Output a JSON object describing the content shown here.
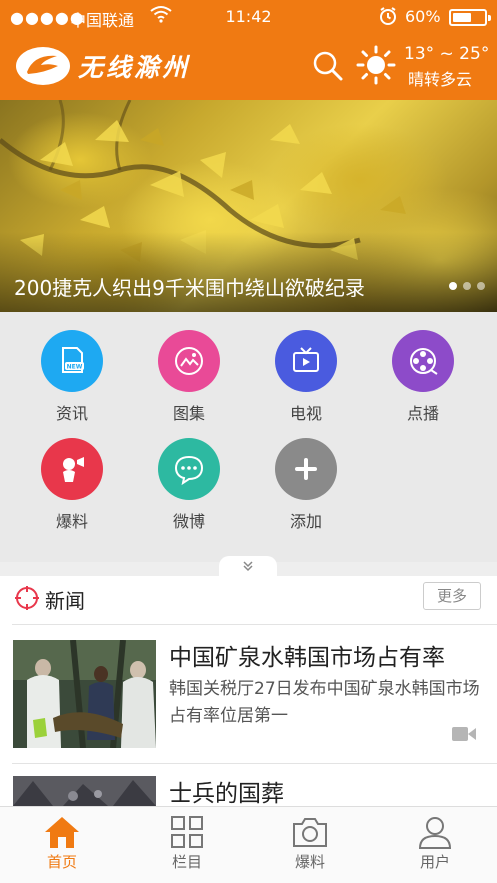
{
  "status_bar": {
    "signal": "●●●●●",
    "carrier": "中国联通",
    "time": "11:42",
    "battery": "60%",
    "battery_level": 0.6
  },
  "header": {
    "app_name": "无线滁州",
    "weather": {
      "temp": "13° ~ 25°",
      "condition": "晴转多云",
      "icon": "sun-icon"
    },
    "icons": [
      "search-icon",
      "sun-icon"
    ]
  },
  "banner": {
    "caption": "200捷克人织出9千米围巾绕山欲破纪录",
    "slides": 3,
    "active_slide": 1
  },
  "grid": {
    "items": [
      {
        "label": "资讯",
        "color": "#1ea9f2",
        "icon": "news-icon"
      },
      {
        "label": "图集",
        "color": "#e94a97",
        "icon": "gallery-icon"
      },
      {
        "label": "电视",
        "color": "#4a5bdf",
        "icon": "tv-icon"
      },
      {
        "label": "点播",
        "color": "#8d4bc9",
        "icon": "film-reel-icon"
      },
      {
        "label": "爆料",
        "color": "#e8374b",
        "icon": "megaphone-icon"
      },
      {
        "label": "微博",
        "color": "#2db9a1",
        "icon": "chat-bubble-icon"
      },
      {
        "label": "添加",
        "color": "#8a8a8a",
        "icon": "plus-icon"
      }
    ]
  },
  "news": {
    "section_title": "新闻",
    "more_label": "更多",
    "articles": [
      {
        "title": "中国矿泉水韩国市场占有率",
        "summary": "韩国关税厅27日发布中国矿泉水韩国市场占有率位居第一",
        "has_video": true
      },
      {
        "title": "士兵的国葬",
        "summary": "",
        "has_video": false
      }
    ]
  },
  "tabbar": {
    "tabs": [
      {
        "label": "首页",
        "icon": "home-icon",
        "active": true
      },
      {
        "label": "栏目",
        "icon": "grid-icon",
        "active": false
      },
      {
        "label": "爆料",
        "icon": "camera-icon",
        "active": false
      },
      {
        "label": "用户",
        "icon": "user-icon",
        "active": false
      }
    ]
  },
  "colors": {
    "brand": "#f07a12",
    "active_tab": "#f07a12"
  }
}
